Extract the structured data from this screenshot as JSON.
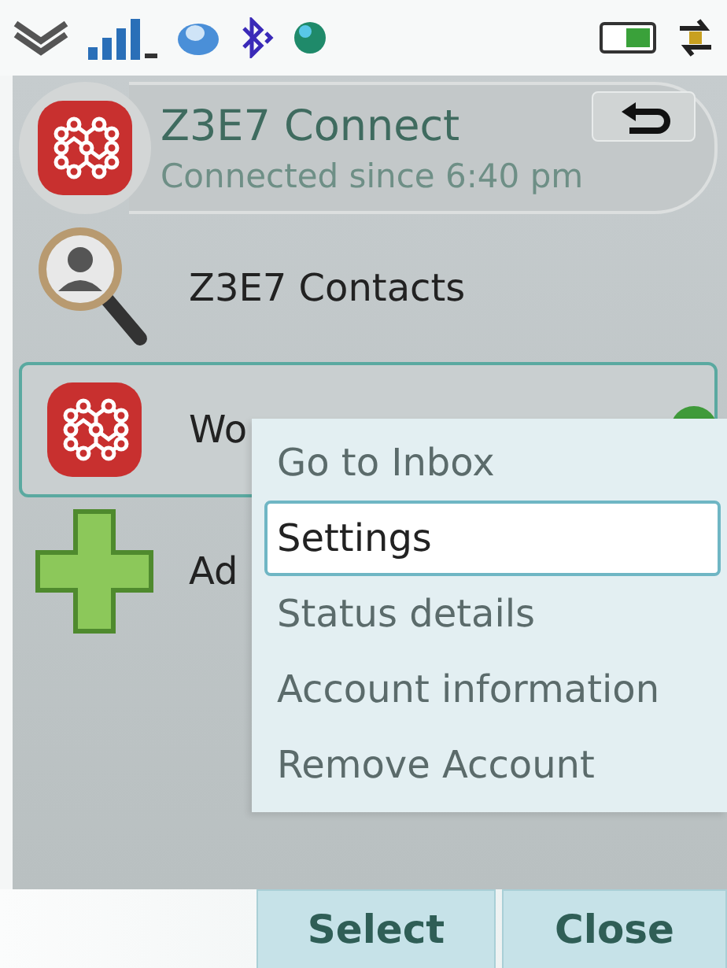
{
  "header": {
    "title": "Z3E7 Connect",
    "subtitle": "Connected since 6:40 pm"
  },
  "items": [
    {
      "kind": "search",
      "label": "Z3E7 Contacts",
      "selected": false,
      "online": false
    },
    {
      "kind": "app",
      "label": "Wo",
      "selected": true,
      "online": true
    },
    {
      "kind": "add",
      "label": "Ad",
      "selected": false,
      "online": false
    }
  ],
  "menu": [
    {
      "label": "Go to Inbox",
      "selected": false
    },
    {
      "label": "Settings",
      "selected": true
    },
    {
      "label": "Status details",
      "selected": false
    },
    {
      "label": "Account information",
      "selected": false
    },
    {
      "label": "Remove Account",
      "selected": false
    }
  ],
  "softkeys": [
    "Select",
    "Close"
  ]
}
